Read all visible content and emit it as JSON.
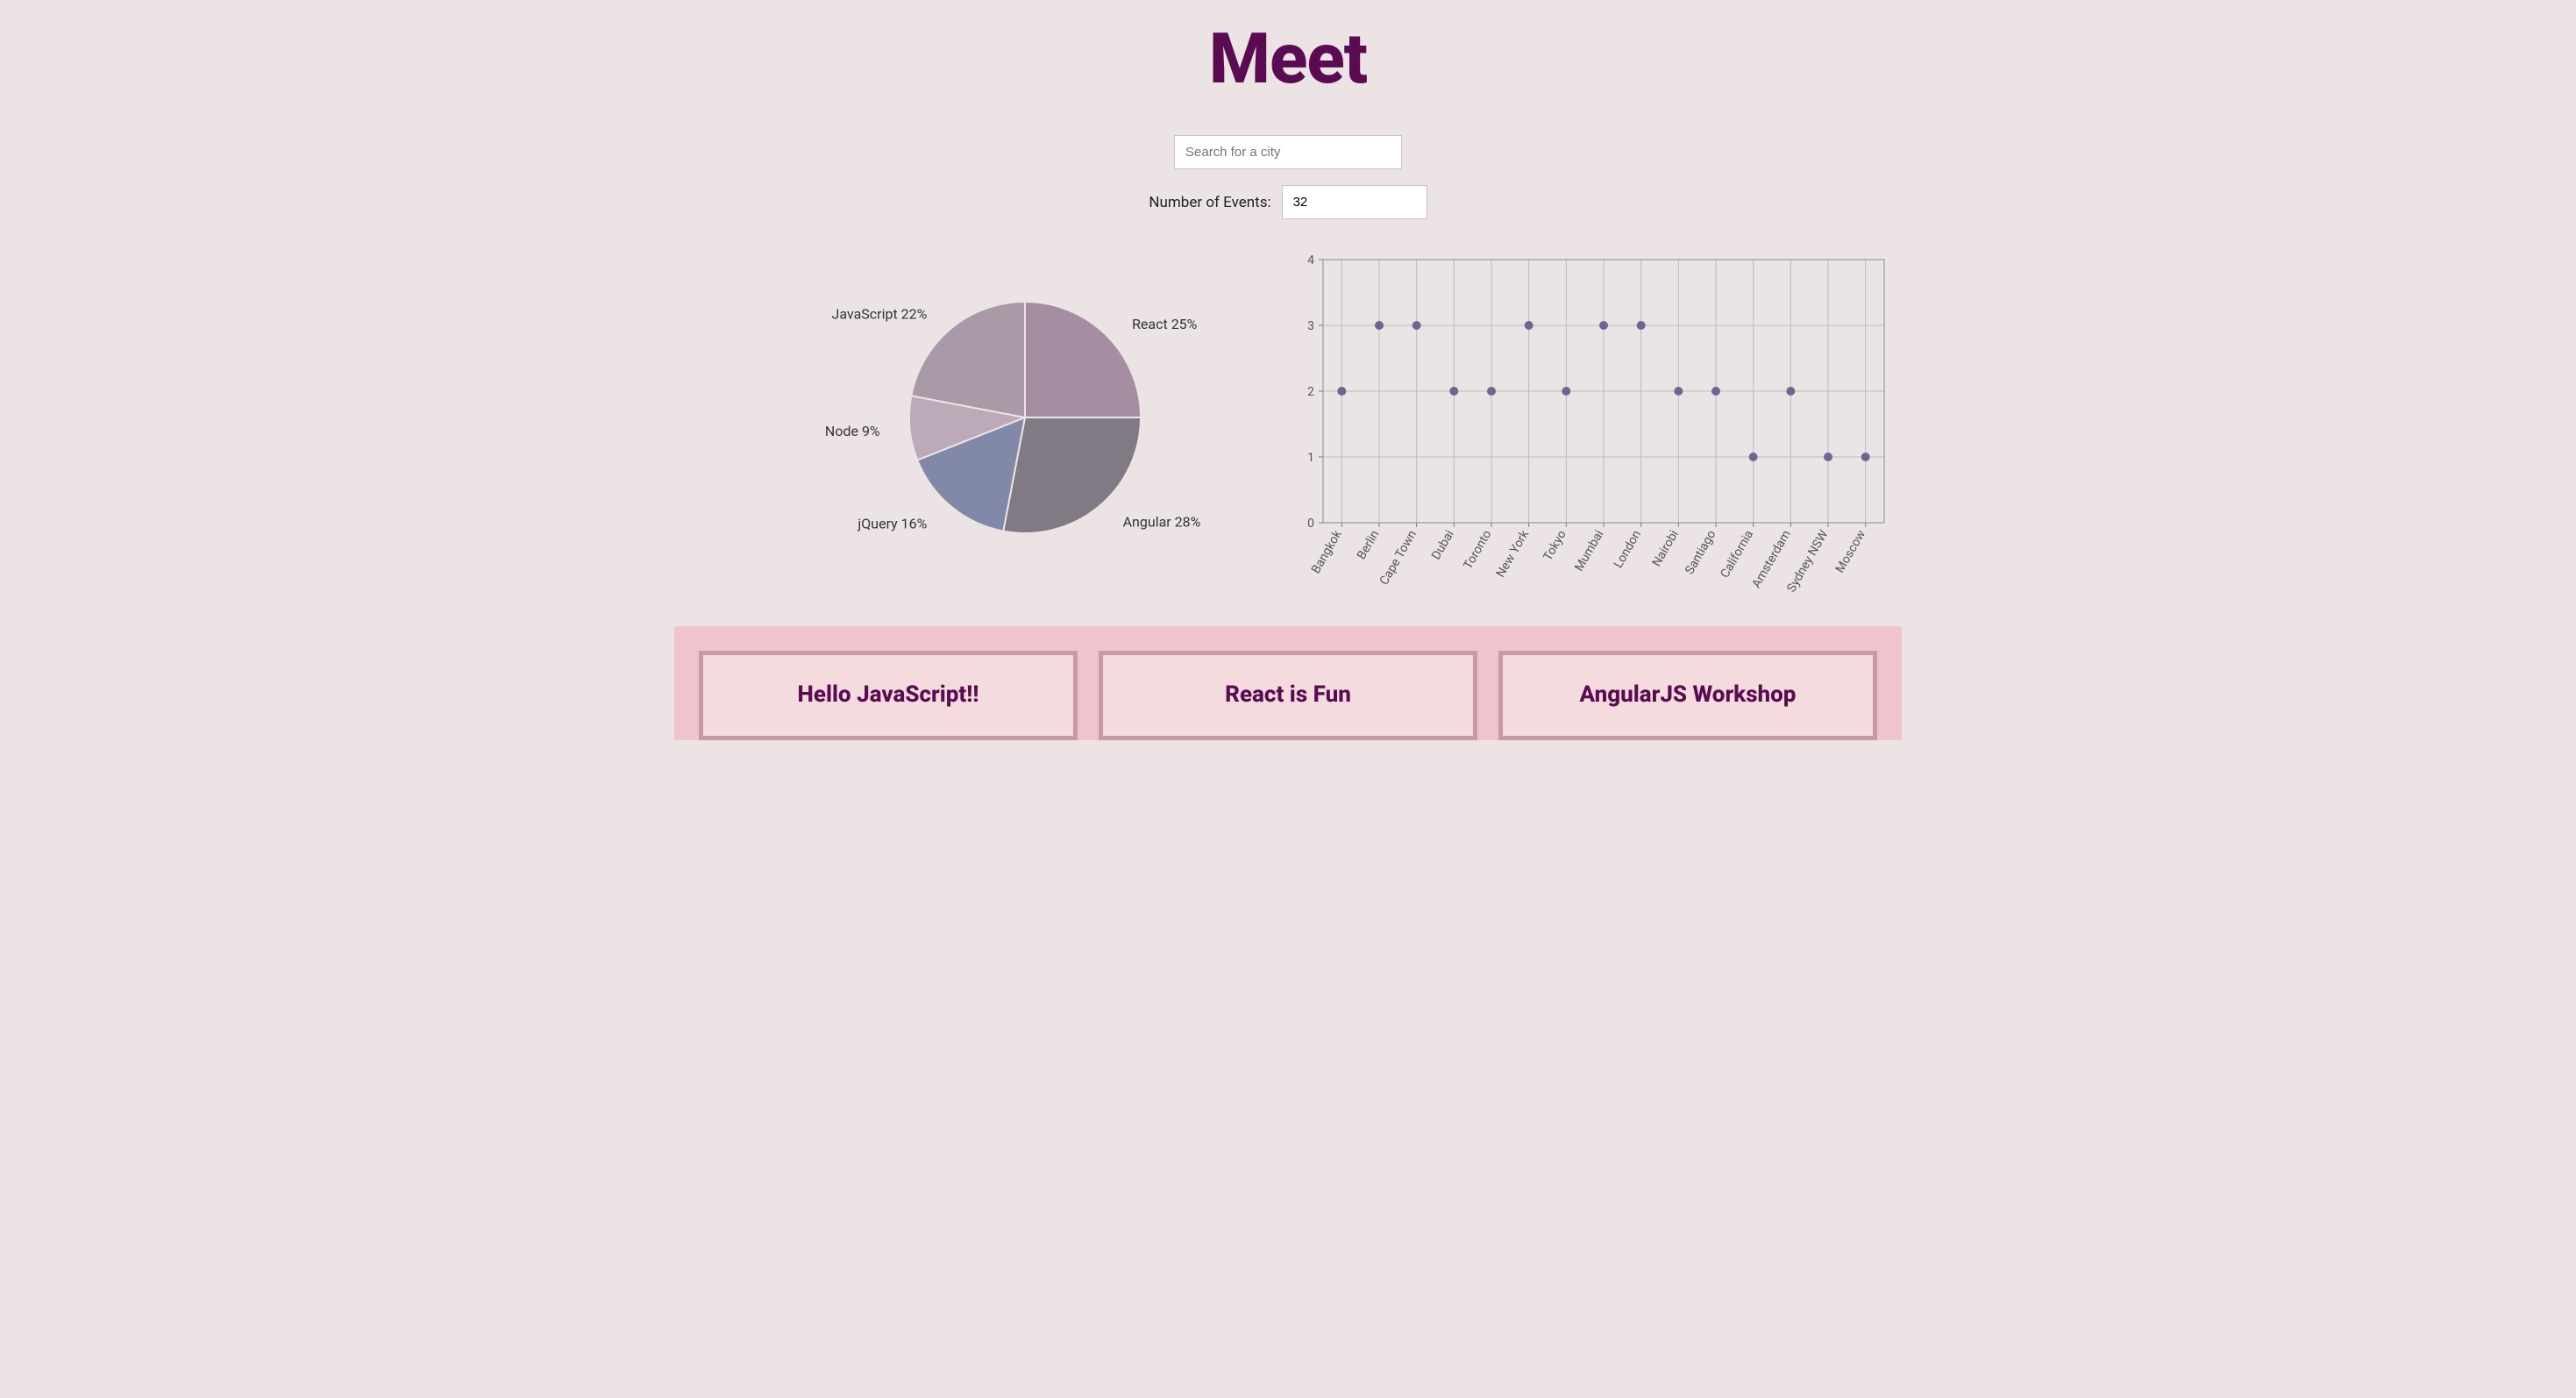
{
  "title": "Meet",
  "search": {
    "placeholder": "Search for a city",
    "value": ""
  },
  "numEvents": {
    "label": "Number of Events:",
    "value": "32"
  },
  "chart_data": [
    {
      "type": "pie",
      "title": "",
      "slices": [
        {
          "name": "React",
          "percent": 25,
          "label": "React 25%",
          "color": "#a68ea2"
        },
        {
          "name": "Angular",
          "percent": 28,
          "label": "Angular 28%",
          "color": "#817a84"
        },
        {
          "name": "jQuery",
          "percent": 16,
          "label": "jQuery 16%",
          "color": "#8289a8"
        },
        {
          "name": "Node",
          "percent": 9,
          "label": "Node 9%",
          "color": "#bcaab8"
        },
        {
          "name": "JavaScript",
          "percent": 22,
          "label": "JavaScript 22%",
          "color": "#aa99a7"
        }
      ]
    },
    {
      "type": "scatter",
      "title": "",
      "xlabel": "",
      "ylabel": "",
      "ylim": [
        0,
        4
      ],
      "y_ticks": [
        0,
        1,
        2,
        3,
        4
      ],
      "categories": [
        "Bangkok",
        "Berlin",
        "Cape Town",
        "Dubai",
        "Toronto",
        "New York",
        "Tokyo",
        "Mumbai",
        "London",
        "Nairobi",
        "Santiago",
        "California",
        "Amsterdam",
        "Sydney NSW",
        "Moscow"
      ],
      "values": [
        2,
        3,
        3,
        2,
        2,
        3,
        2,
        3,
        3,
        2,
        2,
        1,
        2,
        1,
        1
      ],
      "point_color": "#6b678f",
      "grid": true
    }
  ],
  "events": [
    {
      "title": "Hello JavaScript!!"
    },
    {
      "title": "React is Fun"
    },
    {
      "title": "AngularJS Workshop"
    }
  ]
}
